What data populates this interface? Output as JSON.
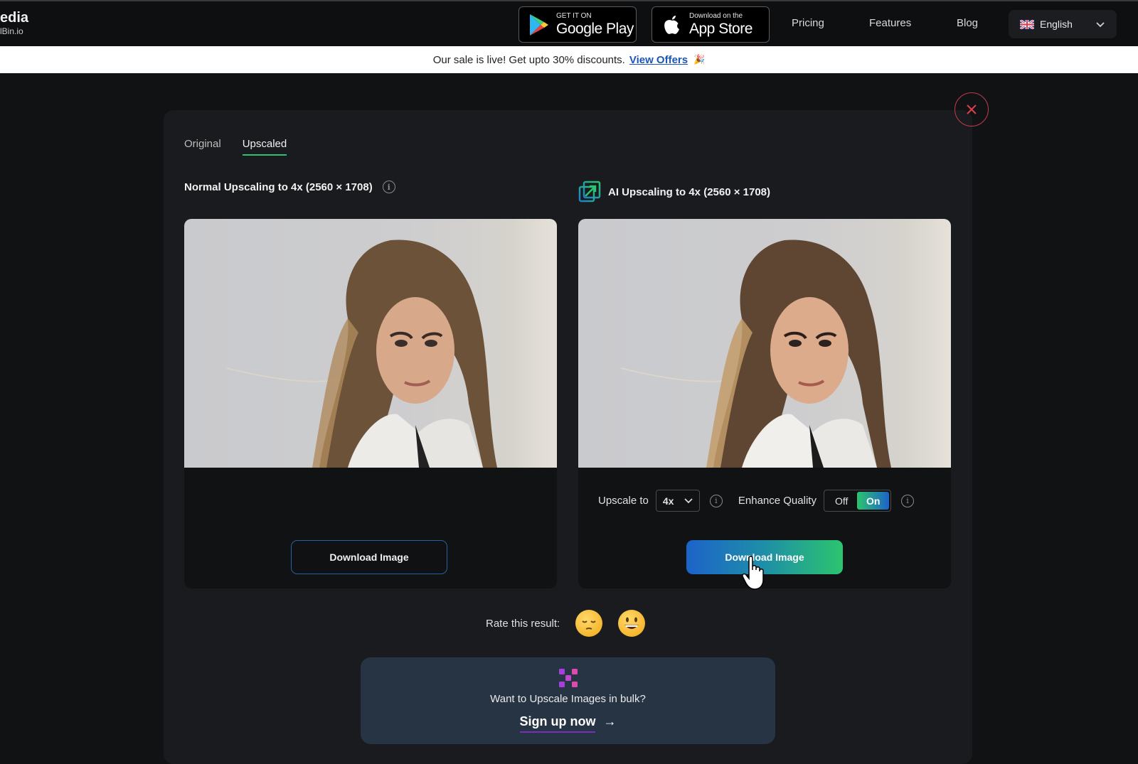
{
  "header": {
    "brand_name": "edia",
    "brand_sub": "lBin.io",
    "google_play": {
      "small": "GET IT ON",
      "big": "Google Play"
    },
    "app_store": {
      "small": "Download on the",
      "big": "App Store"
    },
    "nav": [
      "Pricing",
      "Features",
      "Blog"
    ],
    "language": {
      "label": "English",
      "flag": "uk-flag-icon"
    }
  },
  "banner": {
    "text": "Our sale is live! Get upto 30% discounts.",
    "link": "View Offers",
    "emoji": "🎉"
  },
  "tabs": [
    {
      "label": "Original",
      "active": false
    },
    {
      "label": "Upscaled",
      "active": true
    }
  ],
  "left_column": {
    "title": "Normal Upscaling to 4x (2560 × 1708)",
    "download_label": "Download Image"
  },
  "right_column": {
    "title": "AI Upscaling to 4x (2560 × 1708)",
    "upscale_label": "Upscale to",
    "upscale_value": "4x",
    "enhance_label": "Enhance Quality",
    "toggle_off": "Off",
    "toggle_on": "On",
    "enhance_state": "On",
    "download_label": "Download Image"
  },
  "rating": {
    "label": "Rate this result:",
    "options": [
      "pensive-face",
      "grinning-face"
    ]
  },
  "promo": {
    "question": "Want to Upscale Images in bulk?",
    "cta": "Sign up now",
    "arrow": "→"
  },
  "info_glyph": "i",
  "colors": {
    "accent_green": "#2fbf71",
    "accent_blue": "#1d63c9",
    "close_red": "#c43c4c",
    "link_blue": "#1a56b8"
  }
}
